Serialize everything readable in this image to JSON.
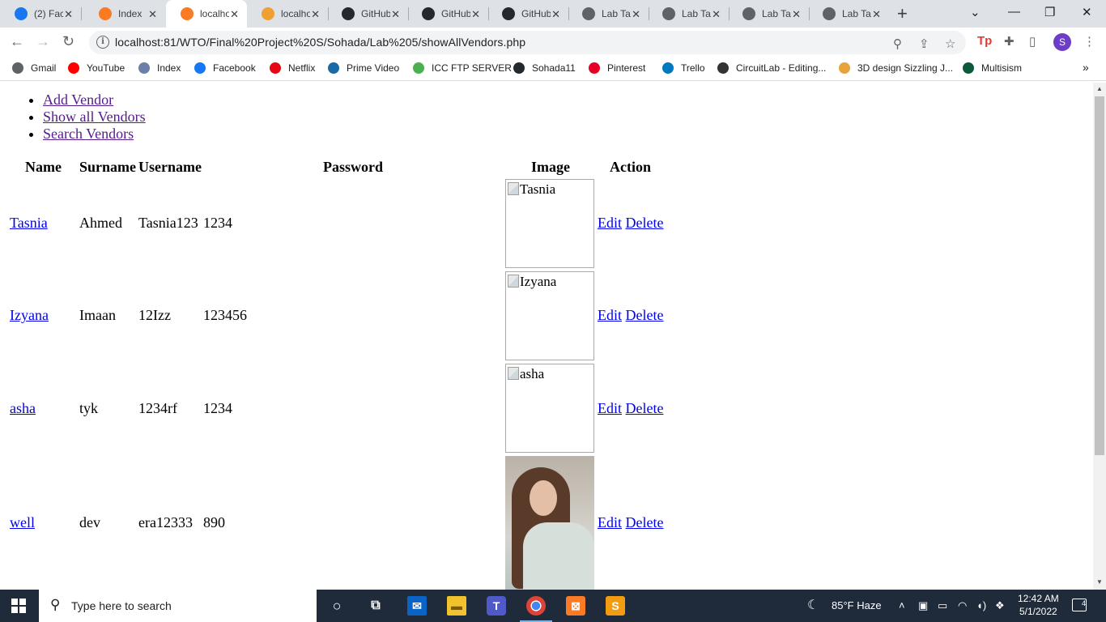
{
  "browser": {
    "tabs": [
      {
        "title": "(2) Fac",
        "icon": "facebook-icon",
        "color": "#1877f2"
      },
      {
        "title": "Index",
        "icon": "xampp-icon",
        "color": "#fb7a24"
      },
      {
        "title": "localho",
        "icon": "xampp-icon",
        "color": "#fb7a24",
        "active": true
      },
      {
        "title": "localho",
        "icon": "phpmyadmin-icon",
        "color": "#f0a030"
      },
      {
        "title": "GitHub",
        "icon": "github-icon",
        "color": "#24292e"
      },
      {
        "title": "GitHub",
        "icon": "github-icon",
        "color": "#24292e"
      },
      {
        "title": "GitHub",
        "icon": "github-icon",
        "color": "#24292e"
      },
      {
        "title": "Lab Ta",
        "icon": "globe-icon",
        "color": "#5f6368"
      },
      {
        "title": "Lab Ta",
        "icon": "globe-icon",
        "color": "#5f6368"
      },
      {
        "title": "Lab Ta",
        "icon": "globe-icon",
        "color": "#5f6368"
      },
      {
        "title": "Lab Ta",
        "icon": "globe-icon",
        "color": "#5f6368"
      }
    ],
    "url": "localhost:81/WTO/Final%20Project%20S/Sohada/Lab%205/showAllVendors.php",
    "profile_initial": "S",
    "bookmarks": [
      {
        "label": "Gmail",
        "icon": "globe-icon",
        "color": "#5f6368"
      },
      {
        "label": "YouTube",
        "icon": "youtube-icon",
        "color": "#ff0000"
      },
      {
        "label": "Index",
        "icon": "globe-icon",
        "color": "#6b7fa8"
      },
      {
        "label": "Facebook",
        "icon": "facebook-icon",
        "color": "#1877f2"
      },
      {
        "label": "Netflix",
        "icon": "netflix-icon",
        "color": "#e50914"
      },
      {
        "label": "Prime Video",
        "icon": "prime-video-icon",
        "color": "#1a6aa8"
      },
      {
        "label": "ICC FTP SERVER",
        "icon": "ftp-icon",
        "color": "#4caf50"
      },
      {
        "label": "Sohada11",
        "icon": "github-icon",
        "color": "#24292e"
      },
      {
        "label": "Pinterest",
        "icon": "pinterest-icon",
        "color": "#e60023"
      },
      {
        "label": "Trello",
        "icon": "trello-icon",
        "color": "#0079bf"
      },
      {
        "label": "CircuitLab - Editing...",
        "icon": "circuitlab-icon",
        "color": "#333333"
      },
      {
        "label": "3D design Sizzling J...",
        "icon": "tinkercad-icon",
        "color": "#e8a33d"
      },
      {
        "label": "Multisism",
        "icon": "multisim-icon",
        "color": "#0c5a3b"
      }
    ]
  },
  "page": {
    "menu": [
      "Add Vendor",
      "Show all Vendors",
      "Search Vendors"
    ],
    "headers": {
      "name": "Name",
      "surname": "Surname",
      "username": "Username",
      "password": "Password",
      "image": "Image",
      "action": "Action"
    },
    "rows": [
      {
        "name": "Tasnia",
        "surname": "Ahmed",
        "username": "Tasnia123",
        "password": "1234",
        "image_alt": "Tasnia",
        "has_image": false
      },
      {
        "name": "Izyana",
        "surname": "Imaan",
        "username": "12Izz",
        "password": "123456",
        "image_alt": "Izyana",
        "has_image": false
      },
      {
        "name": "asha",
        "surname": "tyk",
        "username": "1234rf",
        "password": "1234",
        "image_alt": "asha",
        "has_image": false
      },
      {
        "name": "well",
        "surname": "dev",
        "username": "era12333",
        "password": "890",
        "image_alt": "",
        "has_image": true
      }
    ],
    "edit_label": "Edit",
    "delete_label": "Delete"
  },
  "taskbar": {
    "search_placeholder": "Type here to search",
    "weather": "85°F  Haze",
    "time": "12:42 AM",
    "date": "5/1/2022",
    "notifications": "4"
  }
}
